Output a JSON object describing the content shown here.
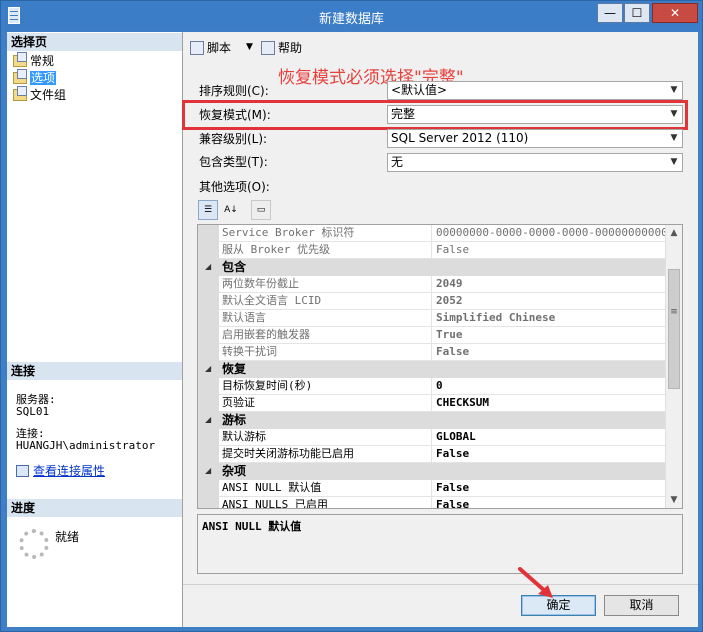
{
  "window": {
    "title": "新建数据库",
    "minimize": "—",
    "maximize": "☐",
    "close": "✕"
  },
  "left_panel": {
    "select_page_header": "选择页",
    "pages": [
      {
        "label": "常规",
        "selected": false
      },
      {
        "label": "选项",
        "selected": true
      },
      {
        "label": "文件组",
        "selected": false
      }
    ],
    "connection_header": "连接",
    "server_label": "服务器:",
    "server_value": "SQL01",
    "connection_label": "连接:",
    "connection_value": "HUANGJH\\administrator",
    "view_conn_link": "查看连接属性",
    "progress_header": "进度",
    "progress_status": "就绪"
  },
  "toolbar": {
    "script_label": "脚本",
    "help_label": "帮助"
  },
  "annotation": "恢复模式必须选择\"完整\"",
  "form": {
    "collation_label": "排序规则(C):",
    "collation_value": "<默认值>",
    "recovery_label": "恢复模式(M):",
    "recovery_value": "完整",
    "compat_label": "兼容级别(L):",
    "compat_value": "SQL Server 2012 (110)",
    "containment_label": "包含类型(T):",
    "containment_value": "无",
    "other_options_label": "其他选项(O):"
  },
  "grid_rows": [
    {
      "type": "prop",
      "name": "Service Broker 标识符",
      "value": "00000000-0000-0000-0000-000000000000",
      "style": "dim"
    },
    {
      "type": "prop",
      "name": "服从 Broker 优先级",
      "value": "False",
      "style": "dim"
    },
    {
      "type": "cat",
      "name": "包含"
    },
    {
      "type": "prop",
      "name": "两位数年份截止",
      "value": "2049",
      "style": "dimbold"
    },
    {
      "type": "prop",
      "name": "默认全文语言 LCID",
      "value": "2052",
      "style": "dimbold"
    },
    {
      "type": "prop",
      "name": "默认语言",
      "value": "Simplified Chinese",
      "style": "dimbold"
    },
    {
      "type": "prop",
      "name": "启用嵌套的触发器",
      "value": "True",
      "style": "dimbold"
    },
    {
      "type": "prop",
      "name": "转换干扰词",
      "value": "False",
      "style": "dimbold"
    },
    {
      "type": "cat",
      "name": "恢复"
    },
    {
      "type": "prop",
      "name": "目标恢复时间(秒)",
      "value": "0",
      "style": "bold"
    },
    {
      "type": "prop",
      "name": "页验证",
      "value": "CHECKSUM",
      "style": "bold"
    },
    {
      "type": "cat",
      "name": "游标"
    },
    {
      "type": "prop",
      "name": "默认游标",
      "value": "GLOBAL",
      "style": "bold"
    },
    {
      "type": "prop",
      "name": "提交时关闭游标功能已启用",
      "value": "False",
      "style": "bold"
    },
    {
      "type": "cat",
      "name": "杂项"
    },
    {
      "type": "prop",
      "name": "ANSI NULL 默认值",
      "value": "False",
      "style": "bold"
    },
    {
      "type": "prop",
      "name": "ANSI NULLS 已启用",
      "value": "False",
      "style": "bold"
    }
  ],
  "description": "ANSI NULL 默认值",
  "buttons": {
    "ok": "确定",
    "cancel": "取消"
  },
  "colors": {
    "titlebar": "#3c7dc7",
    "annotation_red": "#e8413c",
    "selection_blue": "#3399ff"
  }
}
